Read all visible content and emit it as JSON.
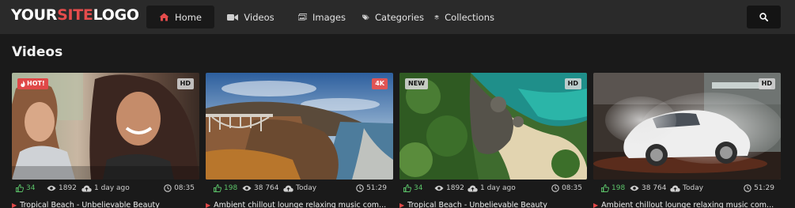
{
  "logo": {
    "part1": "YOUR",
    "part2": "SITE",
    "part3": "LOGO"
  },
  "nav": {
    "items": [
      {
        "label": "Home",
        "icon": "home-icon"
      },
      {
        "label": "Videos",
        "icon": "video-camera-icon"
      },
      {
        "label": "Images",
        "icon": "images-icon"
      },
      {
        "label": "Categories",
        "icon": "tags-icon"
      },
      {
        "label": "Collections",
        "icon": "layers-icon"
      }
    ],
    "search_icon": "search-icon"
  },
  "section": {
    "title": "Videos"
  },
  "colors": {
    "accent": "#e54c4c",
    "likes": "#5cc46a",
    "topbar": "#2a2a2a",
    "background": "#1a1a1a"
  },
  "cards": [
    {
      "badge_left": "HOT!",
      "badge_right": "HD",
      "likes": "34",
      "views": "1892",
      "uploaded": "1 day ago",
      "duration": "08:35",
      "title": "Tropical Beach - Unbelievable Beauty"
    },
    {
      "badge_left": "",
      "badge_right": "4K",
      "likes": "198",
      "views": "38 764",
      "uploaded": "Today",
      "duration": "51:29",
      "title": "Ambient chillout lounge relaxing music com..."
    },
    {
      "badge_left": "NEW",
      "badge_right": "HD",
      "likes": "34",
      "views": "1892",
      "uploaded": "1 day ago",
      "duration": "08:35",
      "title": "Tropical Beach - Unbelievable Beauty"
    },
    {
      "badge_left": "",
      "badge_right": "HD",
      "likes": "198",
      "views": "38 764",
      "uploaded": "Today",
      "duration": "51:29",
      "title": "Ambient chillout lounge relaxing music com..."
    }
  ]
}
